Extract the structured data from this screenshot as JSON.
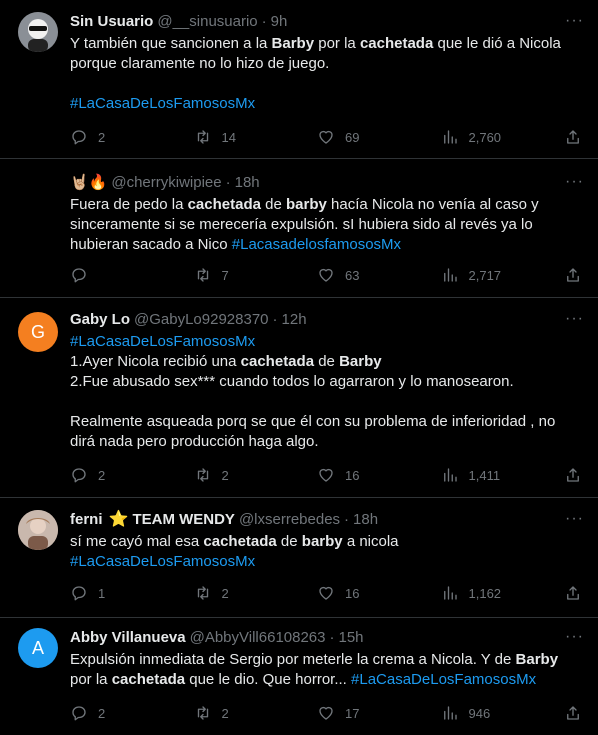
{
  "tweets": [
    {
      "name": "Sin Usuario",
      "handle": "@__sinusuario",
      "time": "9h",
      "line1_a": "Y también que sancionen a la ",
      "line1_b": "Barby",
      "line1_c": " por la ",
      "line1_d": "cachetada",
      "line1_e": " que le dió a Nicola",
      "line2": "porque claramente no lo hizo de juego.",
      "hashtag": "#LaCasaDeLosFamososMx",
      "replies": "2",
      "retweets": "14",
      "likes": "69",
      "views": "2,760"
    },
    {
      "name": "🤘🏼🔥",
      "handle": "@cherrykiwipiee",
      "time": "18h",
      "line1_a": "Fuera de pedo la ",
      "line1_b": "cachetada",
      "line1_c": " de ",
      "line1_d": "barby",
      "line1_e": " hacía Nicola no venía al caso y",
      "line2": "sinceramente si se merecería expulsión. sI hubiera sido al revés ya lo",
      "line3": "hubieran sacado a Nico ",
      "hashtag": "#LacasadelosfamososMx",
      "replies": "",
      "retweets": "7",
      "likes": "63",
      "views": "2,717"
    },
    {
      "avatar_letter": "G",
      "avatar_color": "#f47f20",
      "name": "Gaby Lo",
      "handle": "@GabyLo92928370",
      "time": "12h",
      "hashtag": "#LaCasaDeLosFamososMx",
      "line1_a": "1.Ayer Nicola recibió una ",
      "line1_b": "cachetada",
      "line1_c": " de ",
      "line1_d": "Barby",
      "line2": "2.Fue abusado sex*** cuando todos lo agarraron y lo manosearon.",
      "line3": "Realmente asqueada porq se que él con su problema de inferioridad , no",
      "line4": "dirá nada pero producción haga algo.",
      "replies": "2",
      "retweets": "2",
      "likes": "16",
      "views": "1,411"
    },
    {
      "name": "ferni",
      "star": "⭐",
      "team": "TEAM WENDY",
      "handle": "@lxserrebedes",
      "time": "18h",
      "line1_a": "sí me cayó mal esa ",
      "line1_b": "cachetada",
      "line1_c": " de ",
      "line1_d": "barby",
      "line1_e": " a nicola",
      "hashtag": "#LaCasaDeLosFamososMx",
      "replies": "1",
      "retweets": "2",
      "likes": "16",
      "views": "1,162"
    },
    {
      "avatar_letter": "A",
      "avatar_color": "#1d9bf0",
      "name": "Abby Villanueva",
      "handle": "@AbbyVill66108263",
      "time": "15h",
      "line1": "Expulsión inmediata de Sergio por meterle la crema a Nicola. Y de ",
      "line1_b": "Barby",
      "line2_a": "por la ",
      "line2_b": "cachetada",
      "line2_c": " que le dio. Que horror... ",
      "hashtag": "#LaCasaDeLosFamososMx",
      "replies": "2",
      "retweets": "2",
      "likes": "17",
      "views": "946"
    }
  ],
  "ui": {
    "separator": "·",
    "more": "···"
  },
  "colors": {
    "background": "#000000",
    "text": "#e7e9ea",
    "muted": "#71767b",
    "link": "#1d9bf0",
    "border": "#2f3336"
  },
  "icons": [
    "reply-icon",
    "retweet-icon",
    "like-icon",
    "views-icon",
    "share-icon",
    "more-icon"
  ]
}
